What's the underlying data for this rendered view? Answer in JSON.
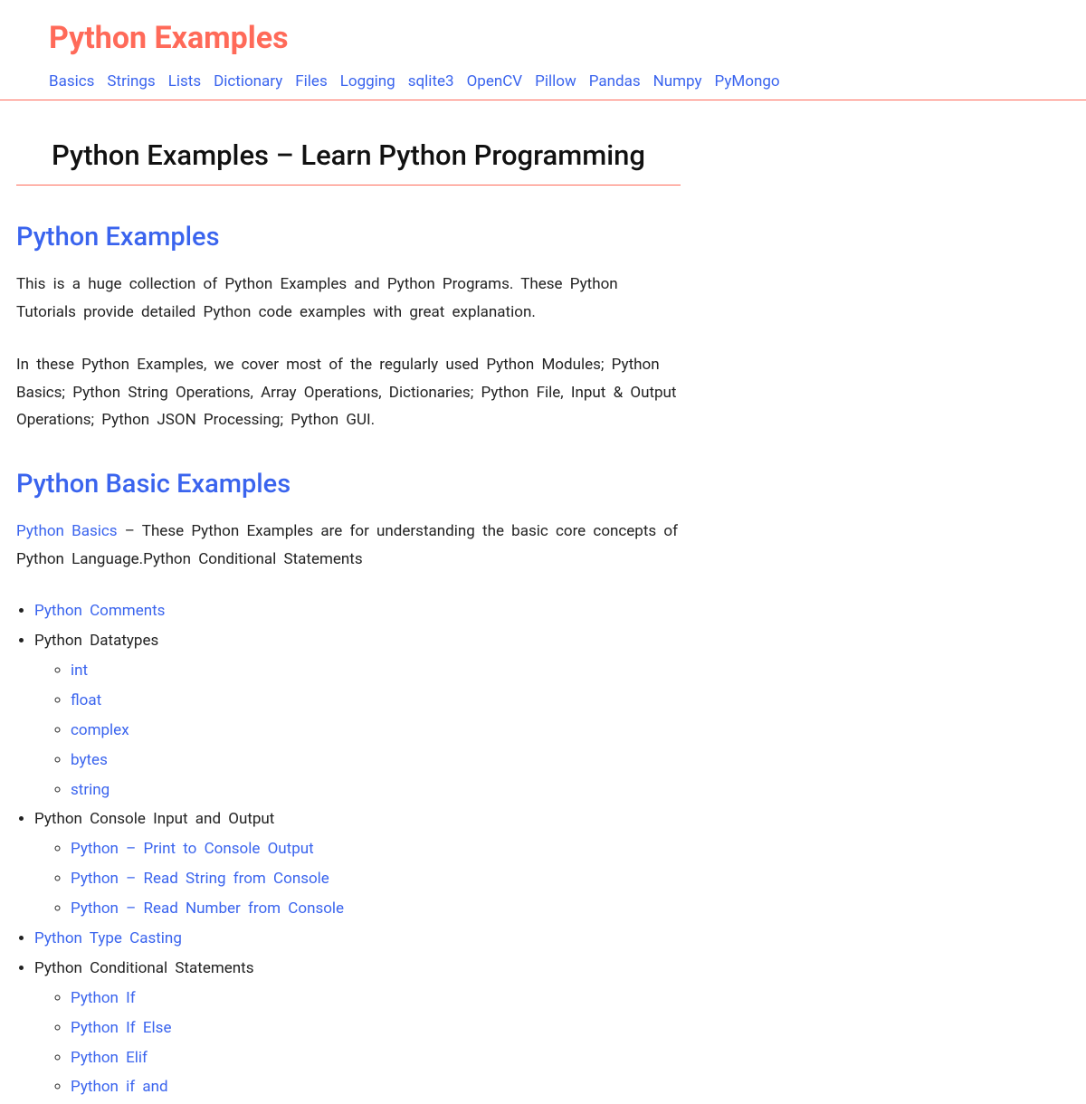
{
  "site_title": "Python Examples",
  "nav": [
    "Basics",
    "Strings",
    "Lists",
    "Dictionary",
    "Files",
    "Logging",
    "sqlite3",
    "OpenCV",
    "Pillow",
    "Pandas",
    "Numpy",
    "PyMongo"
  ],
  "page_title": "Python Examples – Learn Python Programming",
  "sections": {
    "intro": {
      "heading": "Python Examples",
      "p1": "This is a huge collection of Python Examples and Python Programs. These Python Tutorials provide detailed Python code examples with great explanation.",
      "p2": "In these Python Examples, we cover most of the regularly used Python Modules; Python Basics; Python String Operations, Array Operations, Dictionaries; Python File, Input & Output Operations; Python JSON Processing; Python GUI."
    },
    "basics": {
      "heading": "Python Basic Examples",
      "lead_link": "Python Basics",
      "lead_rest": " – These Python Examples are for understanding the basic core concepts of Python Language.Python Conditional Statements",
      "items": [
        {
          "label": "Python Comments",
          "link": true
        },
        {
          "label": "Python Datatypes",
          "link": false,
          "sub": [
            {
              "label": "int",
              "link": true
            },
            {
              "label": "float",
              "link": true
            },
            {
              "label": "complex",
              "link": true
            },
            {
              "label": "bytes",
              "link": true
            },
            {
              "label": "string",
              "link": true
            }
          ]
        },
        {
          "label": "Python Console Input and Output",
          "link": false,
          "sub": [
            {
              "label": "Python – Print to Console Output",
              "link": true
            },
            {
              "label": "Python – Read String from Console",
              "link": true
            },
            {
              "label": "Python – Read Number from Console",
              "link": true
            }
          ]
        },
        {
          "label": "Python Type Casting",
          "link": true
        },
        {
          "label": "Python Conditional Statements",
          "link": false,
          "sub": [
            {
              "label": "Python If",
              "link": true
            },
            {
              "label": "Python If Else",
              "link": true
            },
            {
              "label": "Python Elif",
              "link": true
            },
            {
              "label": "Python if and",
              "link": true
            }
          ]
        }
      ]
    }
  }
}
